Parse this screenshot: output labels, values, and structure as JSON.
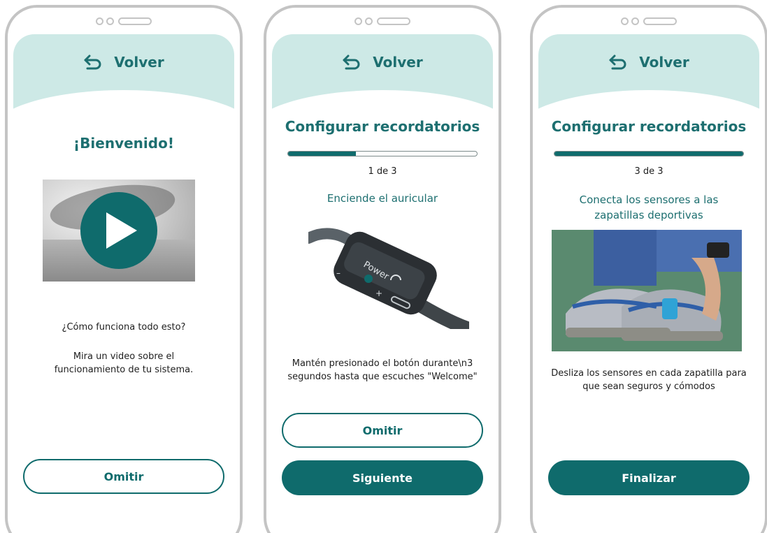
{
  "colors": {
    "primary": "#0f6b6c",
    "header_bg": "#cde9e6",
    "phone_border": "#c4c4c4"
  },
  "icons": {
    "back": "undo-arrow-icon",
    "play": "play-icon"
  },
  "screens": [
    {
      "back_label": "Volver",
      "title": "¡Bienvenido!",
      "question": "¿Cómo funciona todo esto?",
      "description": "Mira un video sobre el funcionamiento de tu sistema.",
      "skip_label": "Omitir"
    },
    {
      "back_label": "Volver",
      "title": "Configurar recordatorios",
      "progress": 0.36,
      "step_label": "1 de 3",
      "subtitle": "Enciende el auricular",
      "device_labels": {
        "power": "Power",
        "minus": "–",
        "plus": "+"
      },
      "instruction": "Mantén presionado el botón durante\\n3 segundos hasta que escuches \"Welcome\"",
      "skip_label": "Omitir",
      "next_label": "Siguiente"
    },
    {
      "back_label": "Volver",
      "title": "Configurar recordatorios",
      "progress": 1.0,
      "step_label": "3 de 3",
      "subtitle": "Conecta los sensores a las zapatillas deportivas",
      "instruction": "Desliza los sensores en cada zapatilla para que sean seguros y cómodos",
      "finish_label": "Finalizar"
    }
  ]
}
